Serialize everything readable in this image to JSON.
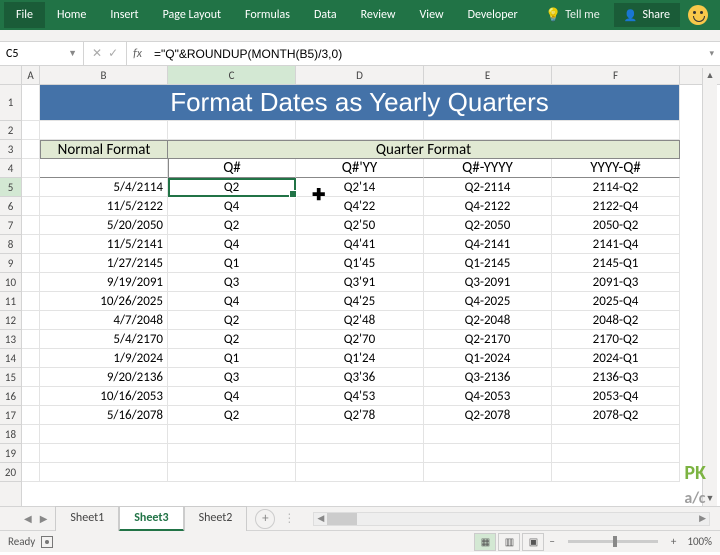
{
  "ribbon": {
    "tabs": [
      "File",
      "Home",
      "Insert",
      "Page Layout",
      "Formulas",
      "Data",
      "Review",
      "View",
      "Developer"
    ],
    "tell_me": "Tell me",
    "share": "Share"
  },
  "namebox": {
    "value": "C5"
  },
  "formula_bar": {
    "value": "=\"Q\"&ROUNDUP(MONTH(B5)/3,0)"
  },
  "columns": [
    "A",
    "B",
    "C",
    "D",
    "E",
    "F"
  ],
  "title": "Format Dates as Yearly Quarters",
  "header3": {
    "left": "Normal Format",
    "right": "Quarter Format"
  },
  "header4": [
    "Q#",
    "Q#'YY",
    "Q#-YYYY",
    "YYYY-Q#"
  ],
  "rows": [
    {
      "n": 5,
      "b": "5/4/2114",
      "c": "Q2",
      "d": "Q2'14",
      "e": "Q2-2114",
      "f": "2114-Q2"
    },
    {
      "n": 6,
      "b": "11/5/2122",
      "c": "Q4",
      "d": "Q4'22",
      "e": "Q4-2122",
      "f": "2122-Q4"
    },
    {
      "n": 7,
      "b": "5/20/2050",
      "c": "Q2",
      "d": "Q2'50",
      "e": "Q2-2050",
      "f": "2050-Q2"
    },
    {
      "n": 8,
      "b": "11/5/2141",
      "c": "Q4",
      "d": "Q4'41",
      "e": "Q4-2141",
      "f": "2141-Q4"
    },
    {
      "n": 9,
      "b": "1/27/2145",
      "c": "Q1",
      "d": "Q1'45",
      "e": "Q1-2145",
      "f": "2145-Q1"
    },
    {
      "n": 10,
      "b": "9/19/2091",
      "c": "Q3",
      "d": "Q3'91",
      "e": "Q3-2091",
      "f": "2091-Q3"
    },
    {
      "n": 11,
      "b": "10/26/2025",
      "c": "Q4",
      "d": "Q4'25",
      "e": "Q4-2025",
      "f": "2025-Q4"
    },
    {
      "n": 12,
      "b": "4/7/2048",
      "c": "Q2",
      "d": "Q2'48",
      "e": "Q2-2048",
      "f": "2048-Q2"
    },
    {
      "n": 13,
      "b": "5/4/2170",
      "c": "Q2",
      "d": "Q2'70",
      "e": "Q2-2170",
      "f": "2170-Q2"
    },
    {
      "n": 14,
      "b": "1/9/2024",
      "c": "Q1",
      "d": "Q1'24",
      "e": "Q1-2024",
      "f": "2024-Q1"
    },
    {
      "n": 15,
      "b": "9/20/2136",
      "c": "Q3",
      "d": "Q3'36",
      "e": "Q3-2136",
      "f": "2136-Q3"
    },
    {
      "n": 16,
      "b": "10/16/2053",
      "c": "Q4",
      "d": "Q4'53",
      "e": "Q4-2053",
      "f": "2053-Q4"
    },
    {
      "n": 17,
      "b": "5/16/2078",
      "c": "Q2",
      "d": "Q2'78",
      "e": "Q2-2078",
      "f": "2078-Q2"
    }
  ],
  "empty_rows": [
    18,
    19,
    20
  ],
  "sheets": [
    "Sheet1",
    "Sheet3",
    "Sheet2"
  ],
  "active_sheet": "Sheet3",
  "status": {
    "ready": "Ready",
    "zoom": "100%"
  },
  "selection": {
    "row": 5,
    "col": "C"
  },
  "chart_data": {
    "type": "table",
    "title": "Format Dates as Yearly Quarters",
    "columns": [
      "Normal Format",
      "Q#",
      "Q#'YY",
      "Q#-YYYY",
      "YYYY-Q#"
    ],
    "records": [
      [
        "5/4/2114",
        "Q2",
        "Q2'14",
        "Q2-2114",
        "2114-Q2"
      ],
      [
        "11/5/2122",
        "Q4",
        "Q4'22",
        "Q4-2122",
        "2122-Q4"
      ],
      [
        "5/20/2050",
        "Q2",
        "Q2'50",
        "Q2-2050",
        "2050-Q2"
      ],
      [
        "11/5/2141",
        "Q4",
        "Q4'41",
        "Q4-2141",
        "2141-Q4"
      ],
      [
        "1/27/2145",
        "Q1",
        "Q1'45",
        "Q1-2145",
        "2145-Q1"
      ],
      [
        "9/19/2091",
        "Q3",
        "Q3'91",
        "Q3-2091",
        "2091-Q3"
      ],
      [
        "10/26/2025",
        "Q4",
        "Q4'25",
        "Q4-2025",
        "2025-Q4"
      ],
      [
        "4/7/2048",
        "Q2",
        "Q2'48",
        "Q2-2048",
        "2048-Q2"
      ],
      [
        "5/4/2170",
        "Q2",
        "Q2'70",
        "Q2-2170",
        "2170-Q2"
      ],
      [
        "1/9/2024",
        "Q1",
        "Q1'24",
        "Q1-2024",
        "2024-Q1"
      ],
      [
        "9/20/2136",
        "Q3",
        "Q3'36",
        "Q3-2136",
        "2136-Q3"
      ],
      [
        "10/16/2053",
        "Q4",
        "Q4'53",
        "Q4-2053",
        "2053-Q4"
      ],
      [
        "5/16/2078",
        "Q2",
        "Q2'78",
        "Q2-2078",
        "2078-Q2"
      ]
    ]
  }
}
